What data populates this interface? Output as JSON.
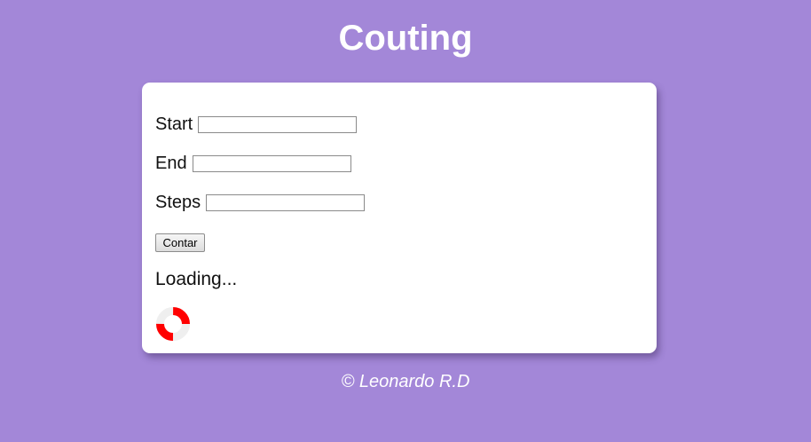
{
  "header": {
    "title": "Couting"
  },
  "form": {
    "start_label": "Start",
    "start_value": "",
    "end_label": "End",
    "end_value": "",
    "steps_label": "Steps",
    "steps_value": "",
    "button_label": "Contar"
  },
  "status": {
    "text": "Loading...",
    "spinner_icon": "loading-spinner-icon",
    "spinner_color": "#ff0000",
    "spinner_track_color": "#efefef"
  },
  "footer": {
    "text": "© Leonardo R.D"
  },
  "colors": {
    "background": "#a387d8",
    "card": "#ffffff"
  }
}
